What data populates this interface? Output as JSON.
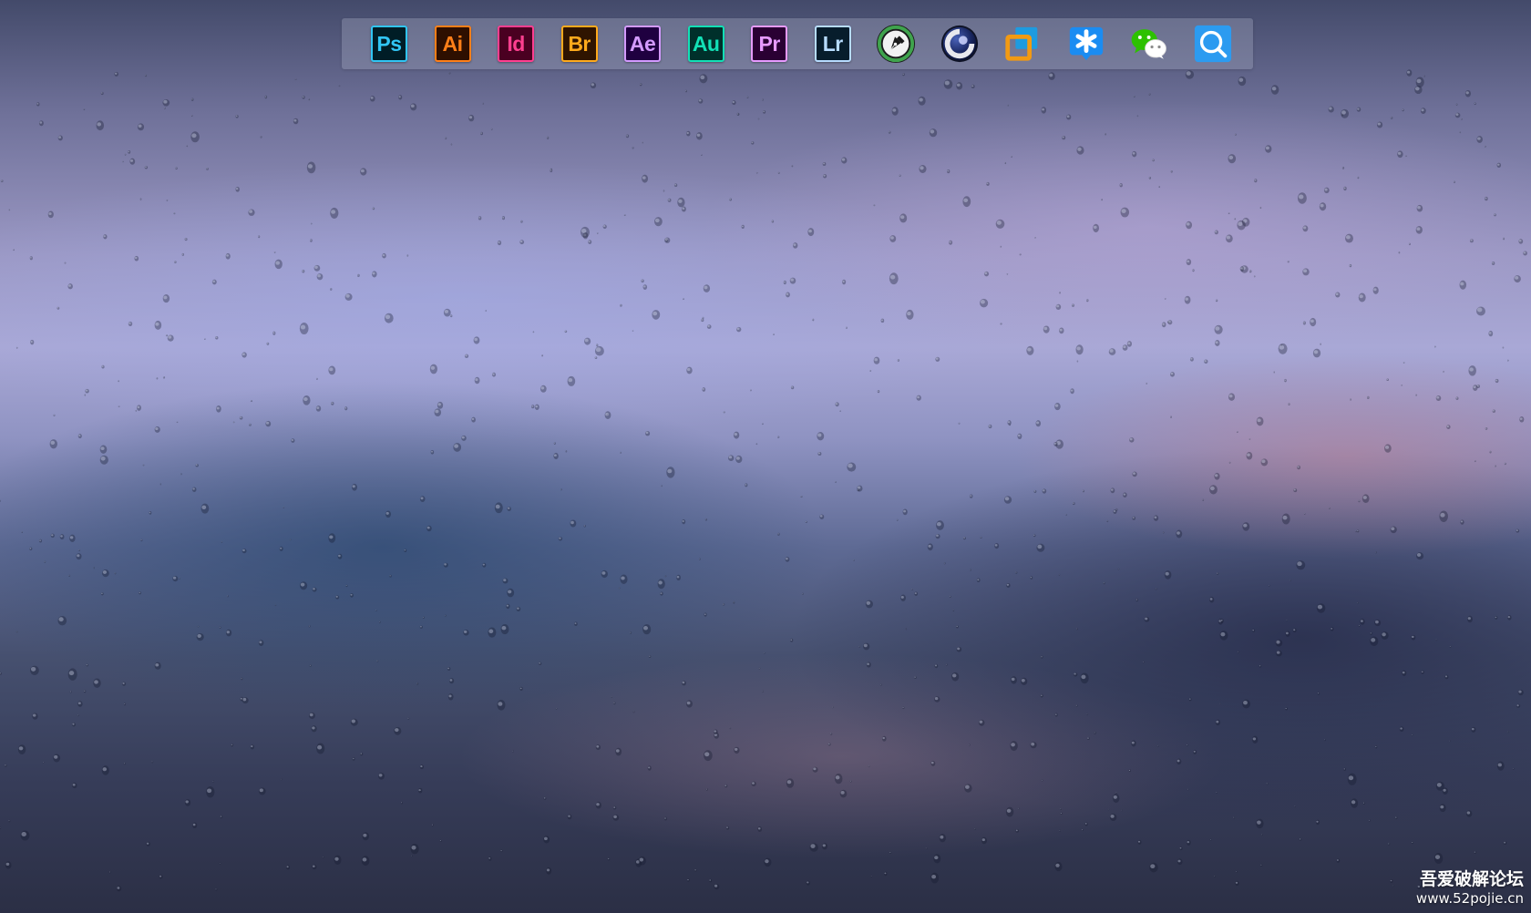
{
  "dock": {
    "items": [
      {
        "label": "Ps",
        "name": "photoshop",
        "fg": "#31c5f4",
        "bg": "#001d26"
      },
      {
        "label": "Ai",
        "name": "illustrator",
        "fg": "#ff7f18",
        "bg": "#2e0f00"
      },
      {
        "label": "Id",
        "name": "indesign",
        "fg": "#ff3f90",
        "bg": "#4a0021"
      },
      {
        "label": "Br",
        "name": "bridge",
        "fg": "#ffaa1c",
        "bg": "#2f1400"
      },
      {
        "label": "Ae",
        "name": "after-effects",
        "fg": "#d39aff",
        "bg": "#1f0040"
      },
      {
        "label": "Au",
        "name": "audition",
        "fg": "#12e0b6",
        "bg": "#00302b"
      },
      {
        "label": "Pr",
        "name": "premiere",
        "fg": "#e79bff",
        "bg": "#2a0033"
      },
      {
        "label": "Lr",
        "name": "lightroom",
        "fg": "#b7dcff",
        "bg": "#071d2c"
      }
    ],
    "extra_icons": [
      {
        "name": "pen-nib-icon"
      },
      {
        "name": "cinema4d-icon"
      },
      {
        "name": "blue-orange-squares-icon"
      },
      {
        "name": "asterisk-chat-icon"
      },
      {
        "name": "wechat-icon"
      },
      {
        "name": "search-icon"
      }
    ]
  },
  "watermark": {
    "title": "吾爱破解论坛",
    "url": "www.52pojie.cn"
  },
  "colors": {
    "pen_green": "#3fa34d",
    "square_blue": "#1e9be0",
    "square_orange": "#f29a12",
    "chat_blue": "#1a8cf2",
    "wechat_green": "#2dc100",
    "search_blue": "#2c9bf0"
  }
}
